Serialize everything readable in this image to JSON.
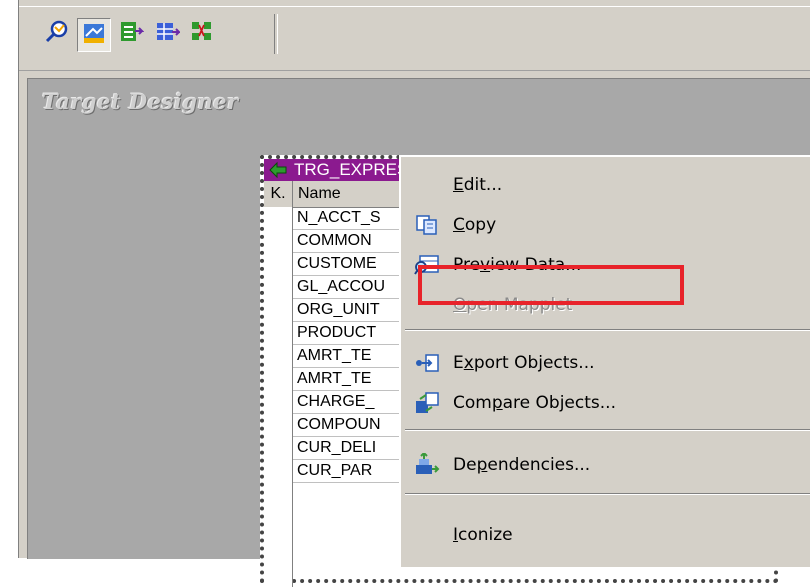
{
  "toolbar": {
    "buttons": [
      {
        "name": "source-analyzer",
        "icon": "source-analyzer-icon"
      },
      {
        "name": "target-designer",
        "icon": "target-designer-icon",
        "active": true
      },
      {
        "name": "transformation-developer",
        "icon": "transformation-developer-icon"
      },
      {
        "name": "mapplet-designer",
        "icon": "mapplet-designer-icon"
      },
      {
        "name": "mapping-designer",
        "icon": "mapping-designer-icon"
      }
    ]
  },
  "workspace": {
    "title": "Target Designer"
  },
  "target_window": {
    "title": "TRG_EXPRESSION_CREDITCARD (",
    "title_button_help": "?",
    "columns": {
      "key": "K.",
      "name": "Name"
    },
    "rows": [
      "N_ACCT_S",
      "COMMON",
      "CUSTOME",
      "GL_ACCOU",
      "ORG_UNIT",
      "PRODUCT",
      "AMRT_TE",
      "AMRT_TE",
      "CHARGE_",
      "COMPOUN",
      "CUR_DELI",
      "CUR_PAR"
    ]
  },
  "context_menu": {
    "items": [
      {
        "label_pre": "",
        "label_ul": "E",
        "label_post": "dit...",
        "icon": "",
        "disabled": false
      },
      {
        "label_pre": "",
        "label_ul": "C",
        "label_post": "opy",
        "icon": "copy-icon",
        "disabled": false
      },
      {
        "label_pre": "Pre",
        "label_ul": "v",
        "label_post": "iew Data...",
        "icon": "preview-data-icon",
        "disabled": false,
        "highlighted": true
      },
      {
        "label_pre": "",
        "label_ul": "O",
        "label_post": "pen Mapplet",
        "icon": "",
        "disabled": true
      },
      {
        "label_pre": "E",
        "label_ul": "x",
        "label_post": "port Objects...",
        "icon": "export-objects-icon",
        "disabled": false
      },
      {
        "label_pre": "Com",
        "label_ul": "p",
        "label_post": "are Objects...",
        "icon": "compare-objects-icon",
        "disabled": false
      },
      {
        "label_pre": "De",
        "label_ul": "p",
        "label_post": "endencies...",
        "icon": "dependencies-icon",
        "disabled": false
      },
      {
        "label_pre": "",
        "label_ul": "I",
        "label_post": "conize",
        "icon": "",
        "disabled": false
      }
    ]
  },
  "colors": {
    "title_bar": "#8b1a8f",
    "workspace": "#a8a8a8",
    "highlight_box": "#e8232a"
  }
}
